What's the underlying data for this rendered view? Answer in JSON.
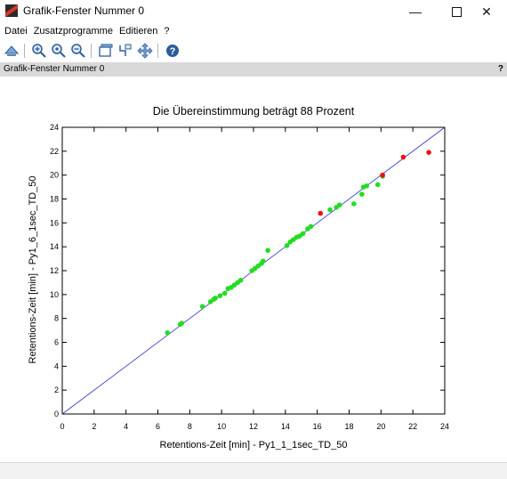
{
  "window": {
    "title": "Grafik-Fenster Nummer 0",
    "minimize_glyph": "—",
    "close_glyph": "✕"
  },
  "menu": [
    {
      "label": "Datei"
    },
    {
      "label": "Zusatzprogramme"
    },
    {
      "label": "Editieren"
    },
    {
      "label": "?"
    }
  ],
  "toolbar": {
    "icons": [
      "rotate-icon",
      "zoom-in-icon",
      "zoom-fit-icon",
      "zoom-out-icon",
      "window-icon",
      "datatip-icon",
      "pan-icon",
      "help-icon"
    ]
  },
  "dock": {
    "title": "Grafik-Fenster Nummer 0",
    "help_label": "?"
  },
  "colors": {
    "line": "#3333cc",
    "green": "#22dd22",
    "red": "#ee1111",
    "dock_bg": "#d9d9d9"
  },
  "chart_data": {
    "type": "scatter",
    "title": "Die Übereinstimmung beträgt 88 Prozent",
    "xlabel": "Retentions-Zeit [min] - Py1_1_1sec_TD_50",
    "ylabel": "Retentions-Zeit [min] - Py1_6_1sec_TD_50",
    "xlim": [
      0,
      24
    ],
    "ylim": [
      0,
      24
    ],
    "xticks": [
      "0",
      "2",
      "4",
      "6",
      "8",
      "10",
      "12",
      "14",
      "16",
      "18",
      "20",
      "22",
      "24"
    ],
    "yticks": [
      "0",
      "2",
      "4",
      "6",
      "8",
      "10",
      "12",
      "14",
      "16",
      "18",
      "20",
      "22",
      "24"
    ],
    "grid": false,
    "reference_line": [
      [
        0,
        0
      ],
      [
        24,
        24
      ]
    ],
    "series": [
      {
        "color": "green",
        "points": [
          [
            6.6,
            6.8
          ],
          [
            7.4,
            7.5
          ],
          [
            7.5,
            7.6
          ],
          [
            8.8,
            9.0
          ],
          [
            9.3,
            9.4
          ],
          [
            9.5,
            9.6
          ],
          [
            9.6,
            9.7
          ],
          [
            9.9,
            9.9
          ],
          [
            10.2,
            10.1
          ],
          [
            10.4,
            10.5
          ],
          [
            10.6,
            10.6
          ],
          [
            10.8,
            10.8
          ],
          [
            11.0,
            11.0
          ],
          [
            11.2,
            11.2
          ],
          [
            11.9,
            12.0
          ],
          [
            12.1,
            12.2
          ],
          [
            12.3,
            12.4
          ],
          [
            12.5,
            12.6
          ],
          [
            12.6,
            12.8
          ],
          [
            12.9,
            13.7
          ],
          [
            14.1,
            14.1
          ],
          [
            14.3,
            14.4
          ],
          [
            14.5,
            14.6
          ],
          [
            14.7,
            14.8
          ],
          [
            14.9,
            14.9
          ],
          [
            15.1,
            15.1
          ],
          [
            15.4,
            15.5
          ],
          [
            15.6,
            15.7
          ],
          [
            16.8,
            17.1
          ],
          [
            17.2,
            17.3
          ],
          [
            17.4,
            17.5
          ],
          [
            18.3,
            17.6
          ],
          [
            18.8,
            18.4
          ],
          [
            18.9,
            19.0
          ],
          [
            19.1,
            19.1
          ],
          [
            19.8,
            19.2
          ],
          [
            20.1,
            19.9
          ]
        ]
      },
      {
        "color": "red",
        "points": [
          [
            16.2,
            16.8
          ],
          [
            20.1,
            20.0
          ],
          [
            21.4,
            21.5
          ],
          [
            23.0,
            21.9
          ]
        ]
      }
    ]
  }
}
